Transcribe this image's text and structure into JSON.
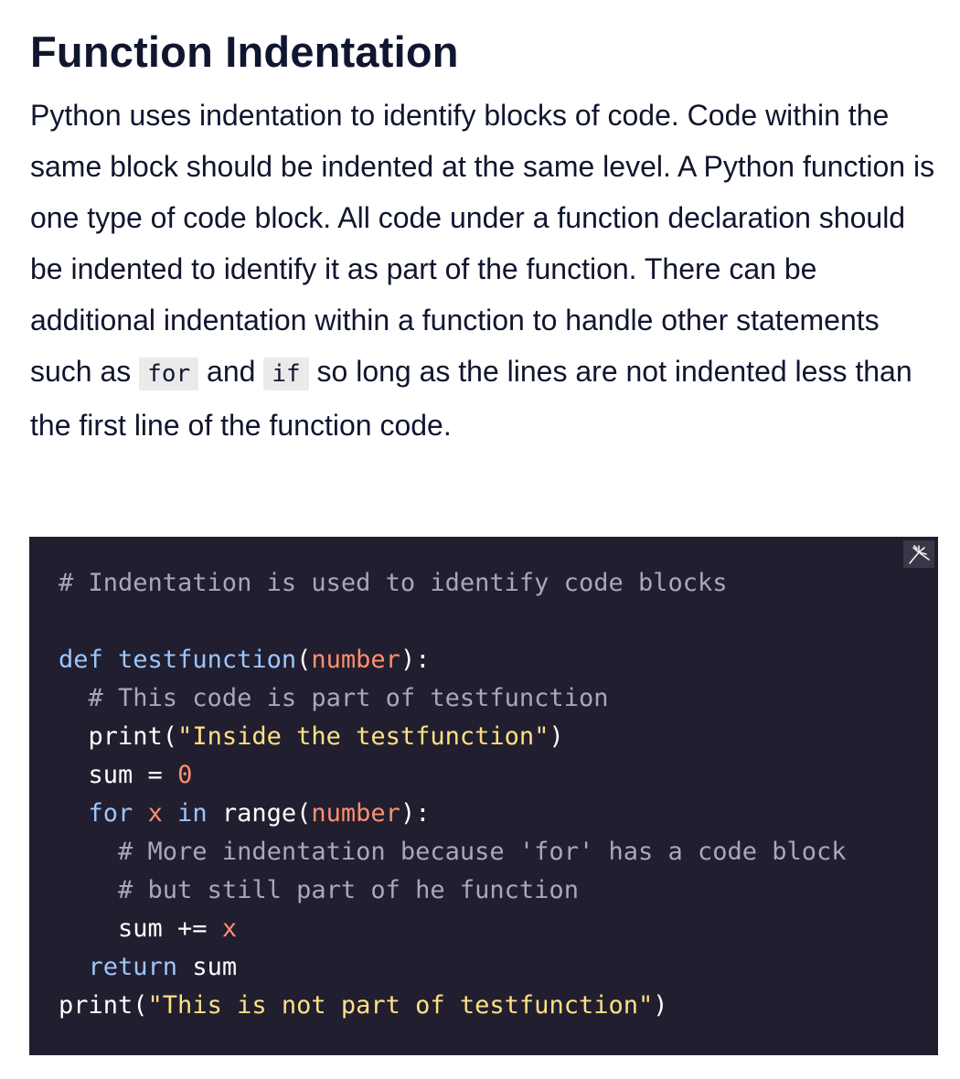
{
  "heading": "Function Indentation",
  "paragraph": {
    "text_before_for": "Python uses indentation to identify blocks of code. Code within the same block should be indented at the same level. A Python function is one type of code block. All code under a function declaration should be indented to identify it as part of the function. There can be additional indentation within a function to handle other statements such as ",
    "code_for": "for",
    "text_between": " and ",
    "code_if": "if",
    "text_after_if": " so long as the lines are not indented less than the first line of the function code."
  },
  "code": {
    "language": "python",
    "background_color": "#211e2f",
    "copy_icon": "copy-icon",
    "lines": {
      "l1_comment": "# Indentation is used to identify code blocks",
      "l3_def": "def",
      "l3_space": " ",
      "l3_name": "testfunction",
      "l3_open": "(",
      "l3_param": "number",
      "l3_close": "):",
      "l4_indent": "  ",
      "l4_comment": "# This code is part of testfunction",
      "l5_indent": "  ",
      "l5_func": "print(",
      "l5_string": "\"Inside the testfunction\"",
      "l5_close": ")",
      "l6_indent": "  ",
      "l6_var": "sum = ",
      "l6_number": "0",
      "l7_indent": "  ",
      "l7_for": "for",
      "l7_sp1": " ",
      "l7_x": "x",
      "l7_sp2": " ",
      "l7_in": "in",
      "l7_range": " range(",
      "l7_param": "number",
      "l7_close": "):",
      "l8_indent": "    ",
      "l8_comment": "# More indentation because 'for' has a code block",
      "l9_indent": "    ",
      "l9_comment": "# but still part of he function",
      "l10_indent": "    ",
      "l10_sum": "sum += ",
      "l10_x": "x",
      "l11_indent": "  ",
      "l11_return": "return",
      "l11_sum": " sum",
      "l12_func": "print(",
      "l12_string": "\"This is not part of testfunction\"",
      "l12_close": ")"
    }
  }
}
